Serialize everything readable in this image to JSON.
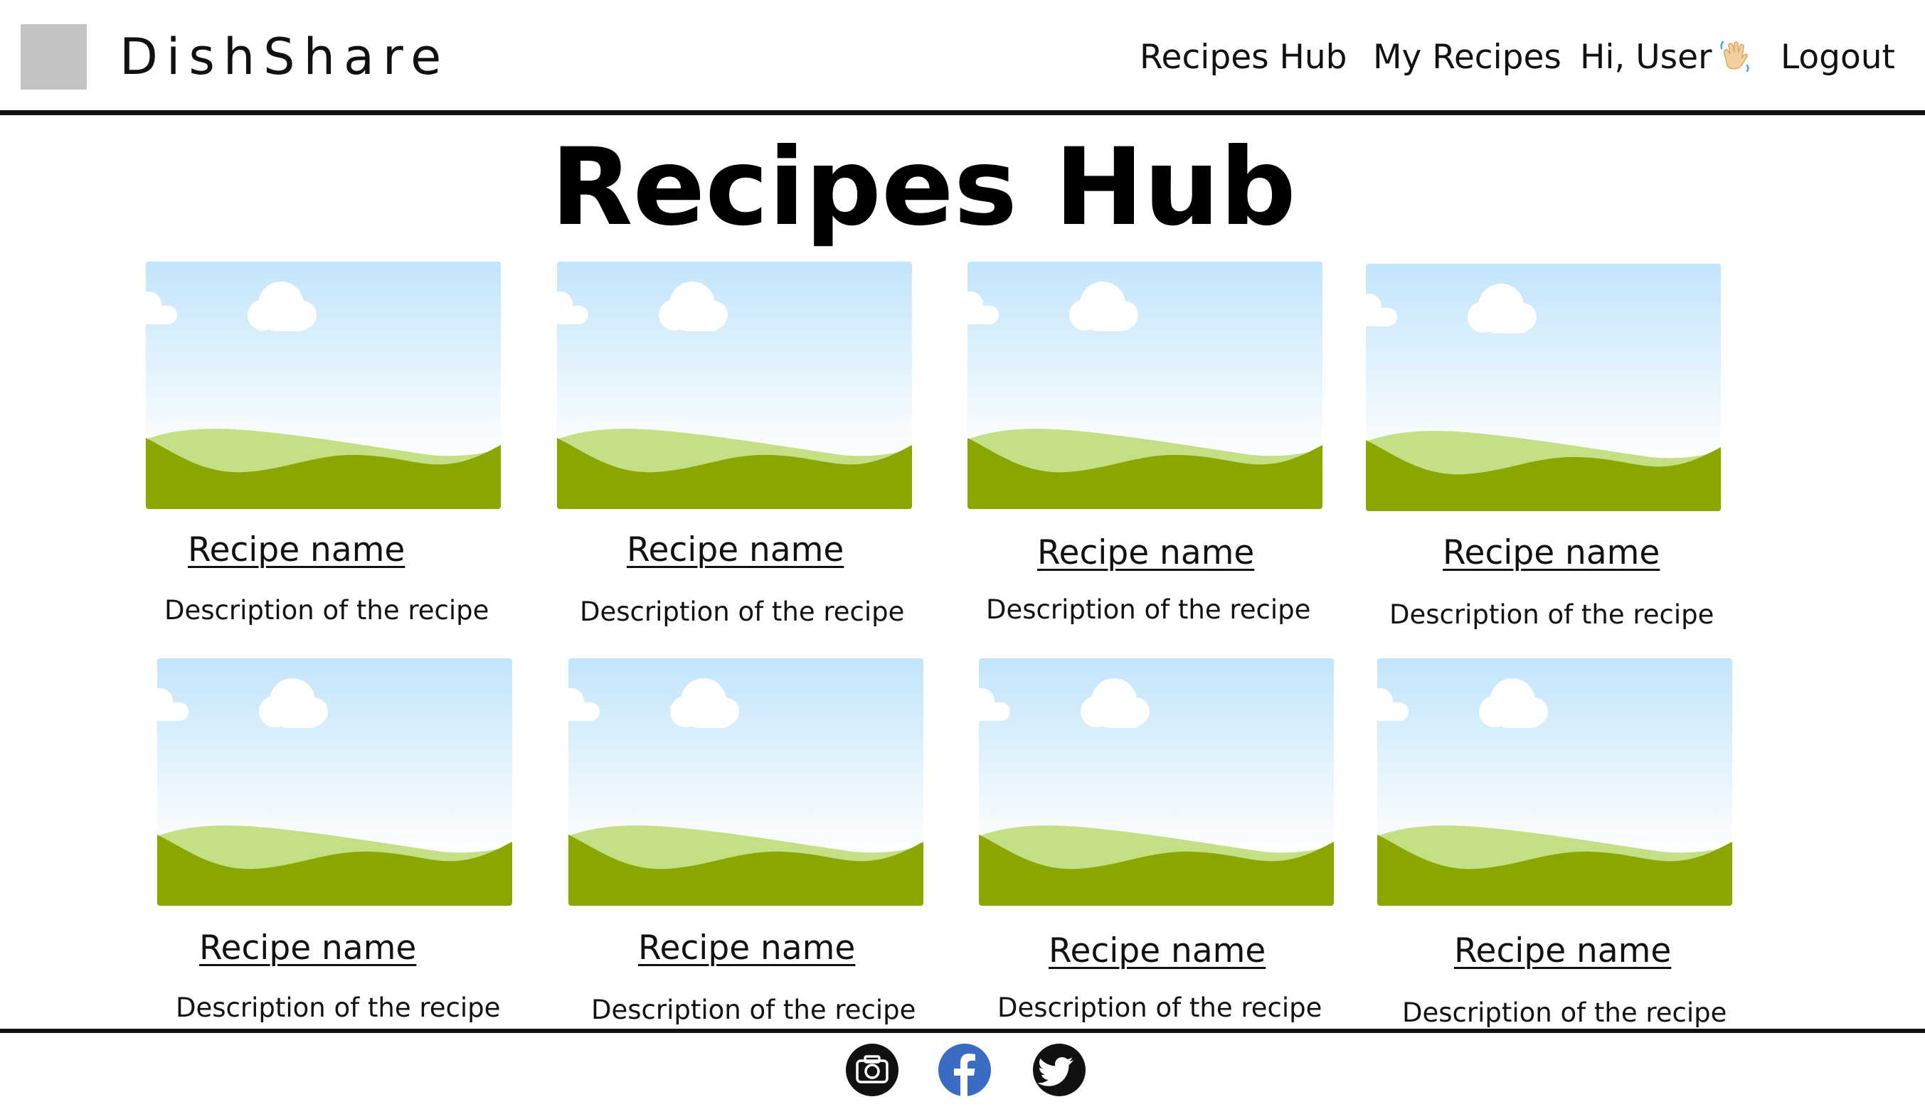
{
  "brand": {
    "name": "DishShare"
  },
  "nav": {
    "recipes_hub": "Recipes Hub",
    "my_recipes": "My Recipes",
    "greeting": "Hi, User",
    "logout": "Logout"
  },
  "page": {
    "title": "Recipes Hub"
  },
  "recipes": [
    {
      "name": "Recipe name",
      "description": "Description of the recipe"
    },
    {
      "name": "Recipe name",
      "description": "Description of the recipe"
    },
    {
      "name": "Recipe name",
      "description": "Description of the recipe"
    },
    {
      "name": "Recipe name",
      "description": "Description of the recipe"
    },
    {
      "name": "Recipe name",
      "description": "Description of the recipe"
    },
    {
      "name": "Recipe name",
      "description": "Description of the recipe"
    },
    {
      "name": "Recipe name",
      "description": "Description of the recipe"
    },
    {
      "name": "Recipe name",
      "description": "Description of the recipe"
    }
  ],
  "footer": {
    "social_icons": [
      "camera-icon",
      "facebook-icon",
      "twitter-icon"
    ]
  },
  "colors": {
    "sky_top": "#c2e5fb",
    "sky_bottom": "#ffffff",
    "hill_light": "#c5df84",
    "hill_dark": "#8aa600",
    "facebook_blue": "#3b6cc4",
    "rule": "#111111"
  }
}
